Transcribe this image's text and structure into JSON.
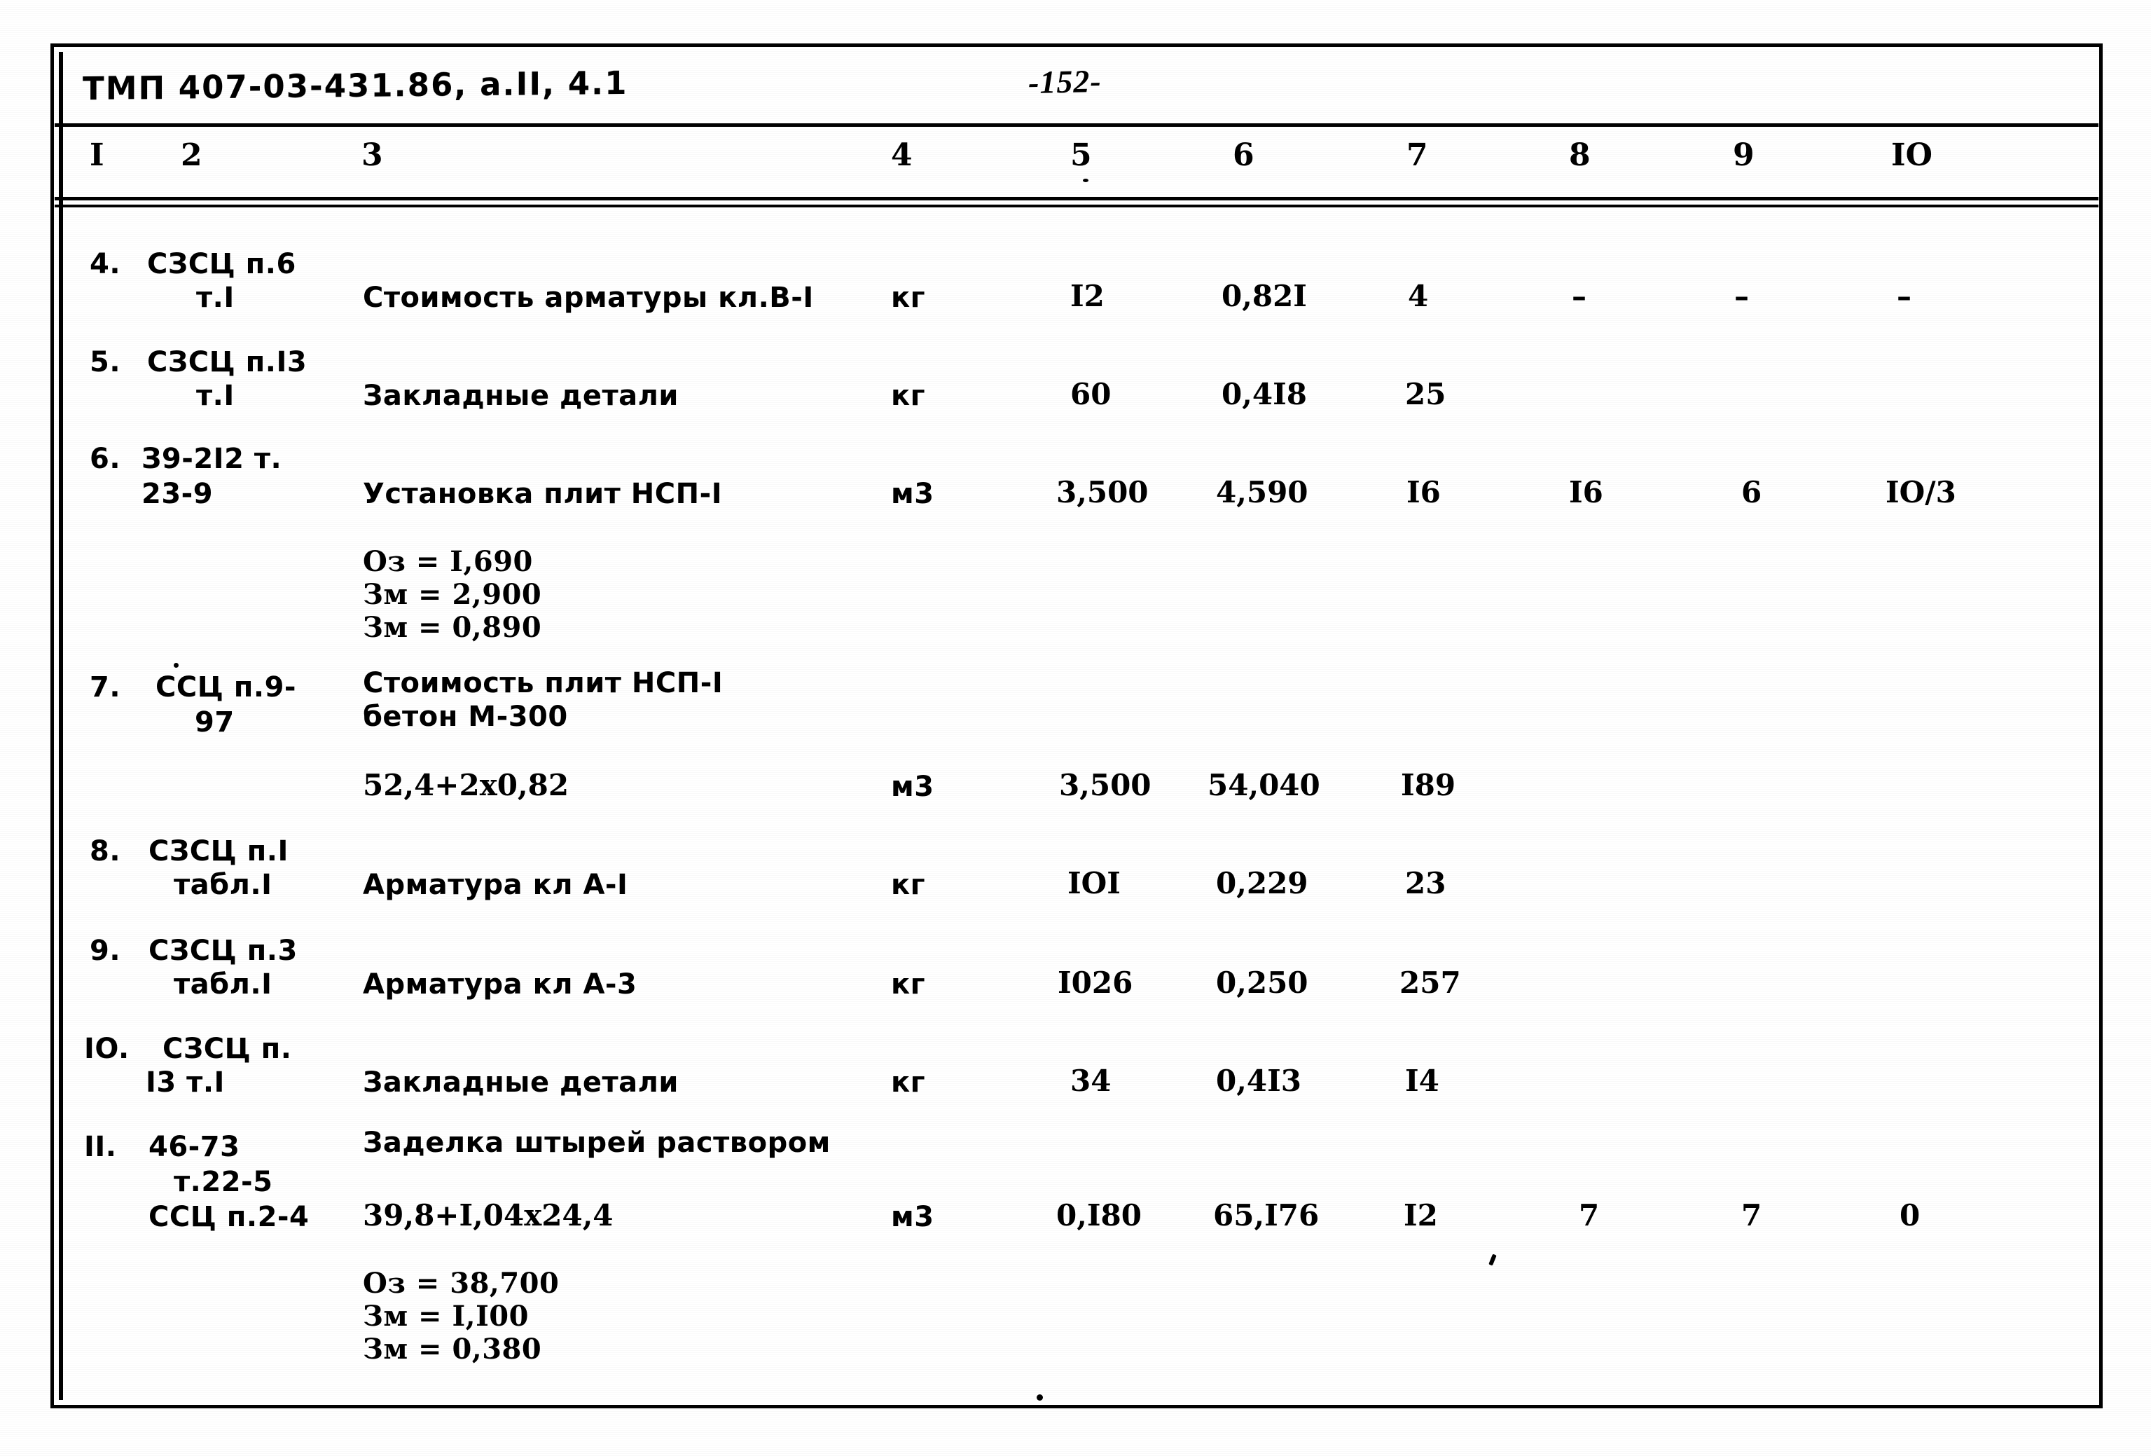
{
  "document": {
    "code": "ТМП 407-03-431.86, а.II, 4.1",
    "page_number": "-152-"
  },
  "table": {
    "column_headers": [
      "I",
      "2",
      "3",
      "4",
      "5",
      "6",
      "7",
      "8",
      "9",
      "IO"
    ],
    "rows": [
      {
        "no": "4.",
        "ref_line1": "СЗСЦ п.6",
        "ref_line2": "т.I",
        "description": "Стоимость арматуры кл.В-I",
        "unit": "кг",
        "c5": "I2",
        "c6": "0,82I",
        "c7": "4",
        "c8": "–",
        "c9": "–",
        "c10": "–",
        "sublines": []
      },
      {
        "no": "5.",
        "ref_line1": "СЗСЦ п.I3",
        "ref_line2": "т.I",
        "description": "Закладные детали",
        "unit": "кг",
        "c5": "60",
        "c6": "0,4I8",
        "c7": "25",
        "c8": "",
        "c9": "",
        "c10": "",
        "sublines": []
      },
      {
        "no": "6.",
        "ref_line1": "З9-2I2 т.",
        "ref_line2": "23-9",
        "description": "Установка плит НСП-I",
        "unit": "м3",
        "c5": "3,500",
        "c6": "4,590",
        "c7": "I6",
        "c8": "I6",
        "c9": "6",
        "c10": "IO/3",
        "sublines": [
          "Оз = I,690",
          "Зм = 2,900",
          "Зм = 0,890"
        ]
      },
      {
        "no": "7.",
        "ref_line1": "ССЦ п.9-",
        "ref_line2": "97",
        "description": "Стоимость плит НСП-I",
        "description2": "бетон М-300",
        "formula": "52,4+2х0,82",
        "unit": "м3",
        "c5": "3,500",
        "c6": "54,040",
        "c7": "I89",
        "c8": "",
        "c9": "",
        "c10": "",
        "sublines": []
      },
      {
        "no": "8.",
        "ref_line1": "СЗСЦ п.I",
        "ref_line2": "табл.I",
        "description": "Арматура кл А-I",
        "unit": "кг",
        "c5": "IOI",
        "c6": "0,229",
        "c7": "23",
        "c8": "",
        "c9": "",
        "c10": "",
        "sublines": []
      },
      {
        "no": "9.",
        "ref_line1": "СЗСЦ п.3",
        "ref_line2": "табл.I",
        "description": "Арматура кл А-3",
        "unit": "кг",
        "c5": "I026",
        "c6": "0,250",
        "c7": "257",
        "c8": "",
        "c9": "",
        "c10": "",
        "sublines": []
      },
      {
        "no": "IO.",
        "ref_line1": "СЗСЦ п.",
        "ref_line2": "I3 т.I",
        "description": "Закладные детали",
        "unit": "кг",
        "c5": "34",
        "c6": "0,4I3",
        "c7": "I4",
        "c8": "",
        "c9": "",
        "c10": "",
        "sublines": []
      },
      {
        "no": "II.",
        "ref_line1": "46-73",
        "ref_line2": "т.22-5",
        "ref_line3": "ССЦ п.2-4",
        "description": "Заделка штырей раствором",
        "formula": "39,8+I,04х24,4",
        "unit": "м3",
        "c5": "0,I80",
        "c6": "65,I76",
        "c7": "I2",
        "c8": "7",
        "c9": "7",
        "c10": "0",
        "sublines": [
          "Оз = 38,700",
          "Зм = I,I00",
          "Зм = 0,380"
        ]
      }
    ]
  }
}
